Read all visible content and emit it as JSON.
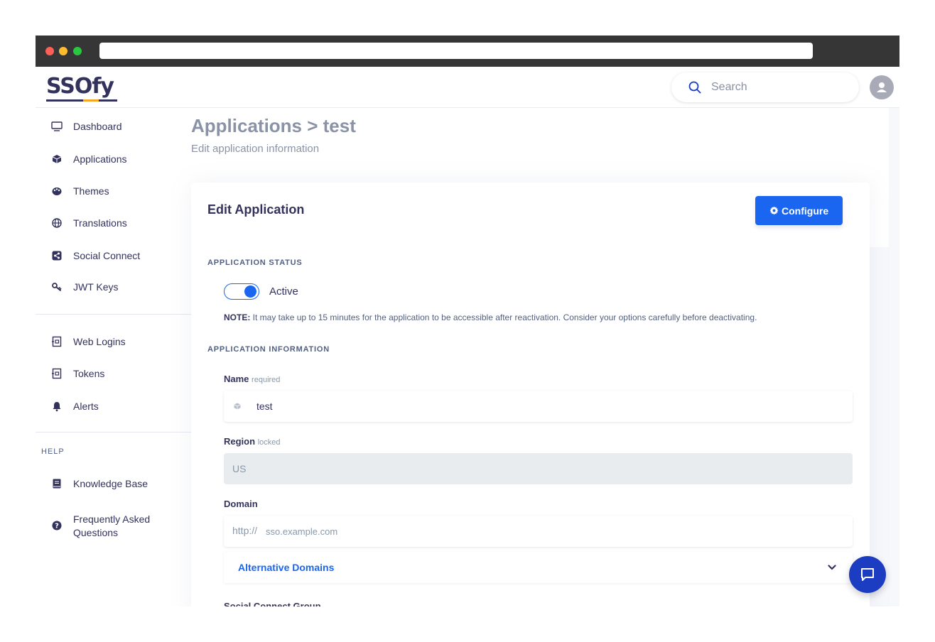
{
  "brand": {
    "logo_text": "SSOfy"
  },
  "search": {
    "placeholder": "Search"
  },
  "sidebar": {
    "items": [
      {
        "label": "Dashboard",
        "icon": "monitor-icon"
      },
      {
        "label": "Applications",
        "icon": "cube-icon"
      },
      {
        "label": "Themes",
        "icon": "palette-icon"
      },
      {
        "label": "Translations",
        "icon": "globe-icon"
      },
      {
        "label": "Social Connect",
        "icon": "share-icon"
      },
      {
        "label": "JWT Keys",
        "icon": "key-icon"
      },
      {
        "label": "Web Logins",
        "icon": "id-card-icon"
      },
      {
        "label": "Tokens",
        "icon": "id-card-icon"
      },
      {
        "label": "Alerts",
        "icon": "bell-icon"
      }
    ],
    "help_label": "HELP",
    "help_items": [
      {
        "label": "Knowledge Base",
        "icon": "book-icon"
      },
      {
        "label": "Frequently Asked Questions",
        "icon": "question-icon"
      }
    ]
  },
  "page": {
    "title": "Applications > test",
    "subtitle": "Edit application information"
  },
  "card": {
    "title": "Edit Application",
    "configure_label": "Configure",
    "status_section": "APPLICATION STATUS",
    "toggle_label": "Active",
    "toggle_on": true,
    "note_prefix": "NOTE:",
    "note_text": " It may take up to 15 minutes for the application to be accessible after reactivation. Consider your options carefully before deactivating.",
    "info_section": "APPLICATION INFORMATION",
    "name_label": "Name",
    "name_hint": "required",
    "name_value": "test",
    "region_label": "Region",
    "region_hint": "locked",
    "region_value": "US",
    "domain_label": "Domain",
    "domain_prefix": "http://",
    "domain_placeholder": "sso.example.com",
    "alt_domains_label": "Alternative Domains",
    "next_label": "Social Connect Group"
  },
  "colors": {
    "primary": "#1a66f0",
    "text": "#32325d",
    "muted": "#8a93a6",
    "chat": "#1c3cc2"
  }
}
